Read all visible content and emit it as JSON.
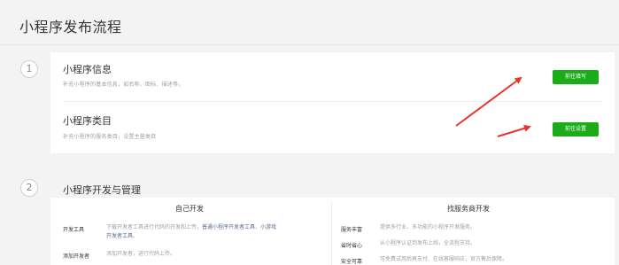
{
  "page": {
    "title": "小程序发布流程"
  },
  "steps": [
    {
      "number": "1"
    },
    {
      "number": "2"
    }
  ],
  "section1": {
    "rows": [
      {
        "title": "小程序信息",
        "desc": "补充小程序的基本信息，如名称、图标、描述等。",
        "button": "前往填写"
      },
      {
        "title": "小程序类目",
        "desc": "补充小程序的服务类目，设置主营类目",
        "button": "前往设置"
      }
    ]
  },
  "section2": {
    "title": "小程序开发与管理",
    "self_dev": {
      "heading": "自己开发",
      "items": [
        {
          "label": "开发工具",
          "text_a": "下载开发者工具进行代码的开发和上传，",
          "link_a": "普通小程序开发者工具",
          "sep": "、",
          "link_b": "小游戏",
          "link_c": "开发者工具",
          "end": "。"
        },
        {
          "label": "添加开发者",
          "text": "添加开发者，进行代码上传。"
        }
      ]
    },
    "provider_dev": {
      "heading": "找服务商开发",
      "items": [
        {
          "label": "服务丰富",
          "text": "提供多行业、多功能的小程序开发服务。"
        },
        {
          "label": "省时省心",
          "text": "从小程序认证到发布上线，全流程支持。"
        },
        {
          "label": "安全可靠",
          "text": "可免费试用后再支付、在线客服响应，官方售后保障。"
        }
      ]
    }
  },
  "colors": {
    "accent_green": "#1aad19",
    "arrow_red": "#e8342a",
    "link": "#576b95"
  }
}
